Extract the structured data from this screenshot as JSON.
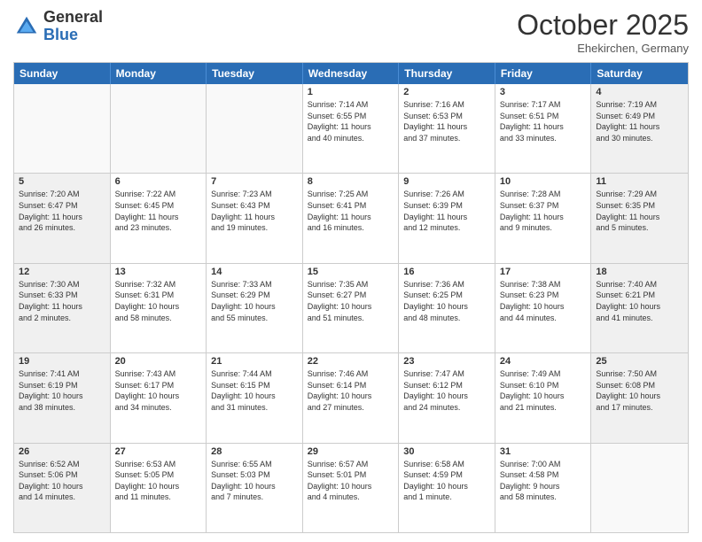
{
  "header": {
    "logo_general": "General",
    "logo_blue": "Blue",
    "month_title": "October 2025",
    "location": "Ehekirchen, Germany"
  },
  "days_of_week": [
    "Sunday",
    "Monday",
    "Tuesday",
    "Wednesday",
    "Thursday",
    "Friday",
    "Saturday"
  ],
  "rows": [
    [
      {
        "day": "",
        "info": "",
        "empty": true
      },
      {
        "day": "",
        "info": "",
        "empty": true
      },
      {
        "day": "",
        "info": "",
        "empty": true
      },
      {
        "day": "1",
        "info": "Sunrise: 7:14 AM\nSunset: 6:55 PM\nDaylight: 11 hours\nand 40 minutes.",
        "empty": false
      },
      {
        "day": "2",
        "info": "Sunrise: 7:16 AM\nSunset: 6:53 PM\nDaylight: 11 hours\nand 37 minutes.",
        "empty": false
      },
      {
        "day": "3",
        "info": "Sunrise: 7:17 AM\nSunset: 6:51 PM\nDaylight: 11 hours\nand 33 minutes.",
        "empty": false
      },
      {
        "day": "4",
        "info": "Sunrise: 7:19 AM\nSunset: 6:49 PM\nDaylight: 11 hours\nand 30 minutes.",
        "empty": false,
        "shaded": true
      }
    ],
    [
      {
        "day": "5",
        "info": "Sunrise: 7:20 AM\nSunset: 6:47 PM\nDaylight: 11 hours\nand 26 minutes.",
        "empty": false,
        "shaded": true
      },
      {
        "day": "6",
        "info": "Sunrise: 7:22 AM\nSunset: 6:45 PM\nDaylight: 11 hours\nand 23 minutes.",
        "empty": false
      },
      {
        "day": "7",
        "info": "Sunrise: 7:23 AM\nSunset: 6:43 PM\nDaylight: 11 hours\nand 19 minutes.",
        "empty": false
      },
      {
        "day": "8",
        "info": "Sunrise: 7:25 AM\nSunset: 6:41 PM\nDaylight: 11 hours\nand 16 minutes.",
        "empty": false
      },
      {
        "day": "9",
        "info": "Sunrise: 7:26 AM\nSunset: 6:39 PM\nDaylight: 11 hours\nand 12 minutes.",
        "empty": false
      },
      {
        "day": "10",
        "info": "Sunrise: 7:28 AM\nSunset: 6:37 PM\nDaylight: 11 hours\nand 9 minutes.",
        "empty": false
      },
      {
        "day": "11",
        "info": "Sunrise: 7:29 AM\nSunset: 6:35 PM\nDaylight: 11 hours\nand 5 minutes.",
        "empty": false,
        "shaded": true
      }
    ],
    [
      {
        "day": "12",
        "info": "Sunrise: 7:30 AM\nSunset: 6:33 PM\nDaylight: 11 hours\nand 2 minutes.",
        "empty": false,
        "shaded": true
      },
      {
        "day": "13",
        "info": "Sunrise: 7:32 AM\nSunset: 6:31 PM\nDaylight: 10 hours\nand 58 minutes.",
        "empty": false
      },
      {
        "day": "14",
        "info": "Sunrise: 7:33 AM\nSunset: 6:29 PM\nDaylight: 10 hours\nand 55 minutes.",
        "empty": false
      },
      {
        "day": "15",
        "info": "Sunrise: 7:35 AM\nSunset: 6:27 PM\nDaylight: 10 hours\nand 51 minutes.",
        "empty": false
      },
      {
        "day": "16",
        "info": "Sunrise: 7:36 AM\nSunset: 6:25 PM\nDaylight: 10 hours\nand 48 minutes.",
        "empty": false
      },
      {
        "day": "17",
        "info": "Sunrise: 7:38 AM\nSunset: 6:23 PM\nDaylight: 10 hours\nand 44 minutes.",
        "empty": false
      },
      {
        "day": "18",
        "info": "Sunrise: 7:40 AM\nSunset: 6:21 PM\nDaylight: 10 hours\nand 41 minutes.",
        "empty": false,
        "shaded": true
      }
    ],
    [
      {
        "day": "19",
        "info": "Sunrise: 7:41 AM\nSunset: 6:19 PM\nDaylight: 10 hours\nand 38 minutes.",
        "empty": false,
        "shaded": true
      },
      {
        "day": "20",
        "info": "Sunrise: 7:43 AM\nSunset: 6:17 PM\nDaylight: 10 hours\nand 34 minutes.",
        "empty": false
      },
      {
        "day": "21",
        "info": "Sunrise: 7:44 AM\nSunset: 6:15 PM\nDaylight: 10 hours\nand 31 minutes.",
        "empty": false
      },
      {
        "day": "22",
        "info": "Sunrise: 7:46 AM\nSunset: 6:14 PM\nDaylight: 10 hours\nand 27 minutes.",
        "empty": false
      },
      {
        "day": "23",
        "info": "Sunrise: 7:47 AM\nSunset: 6:12 PM\nDaylight: 10 hours\nand 24 minutes.",
        "empty": false
      },
      {
        "day": "24",
        "info": "Sunrise: 7:49 AM\nSunset: 6:10 PM\nDaylight: 10 hours\nand 21 minutes.",
        "empty": false
      },
      {
        "day": "25",
        "info": "Sunrise: 7:50 AM\nSunset: 6:08 PM\nDaylight: 10 hours\nand 17 minutes.",
        "empty": false,
        "shaded": true
      }
    ],
    [
      {
        "day": "26",
        "info": "Sunrise: 6:52 AM\nSunset: 5:06 PM\nDaylight: 10 hours\nand 14 minutes.",
        "empty": false,
        "shaded": true
      },
      {
        "day": "27",
        "info": "Sunrise: 6:53 AM\nSunset: 5:05 PM\nDaylight: 10 hours\nand 11 minutes.",
        "empty": false
      },
      {
        "day": "28",
        "info": "Sunrise: 6:55 AM\nSunset: 5:03 PM\nDaylight: 10 hours\nand 7 minutes.",
        "empty": false
      },
      {
        "day": "29",
        "info": "Sunrise: 6:57 AM\nSunset: 5:01 PM\nDaylight: 10 hours\nand 4 minutes.",
        "empty": false
      },
      {
        "day": "30",
        "info": "Sunrise: 6:58 AM\nSunset: 4:59 PM\nDaylight: 10 hours\nand 1 minute.",
        "empty": false
      },
      {
        "day": "31",
        "info": "Sunrise: 7:00 AM\nSunset: 4:58 PM\nDaylight: 9 hours\nand 58 minutes.",
        "empty": false
      },
      {
        "day": "",
        "info": "",
        "empty": true
      }
    ]
  ]
}
